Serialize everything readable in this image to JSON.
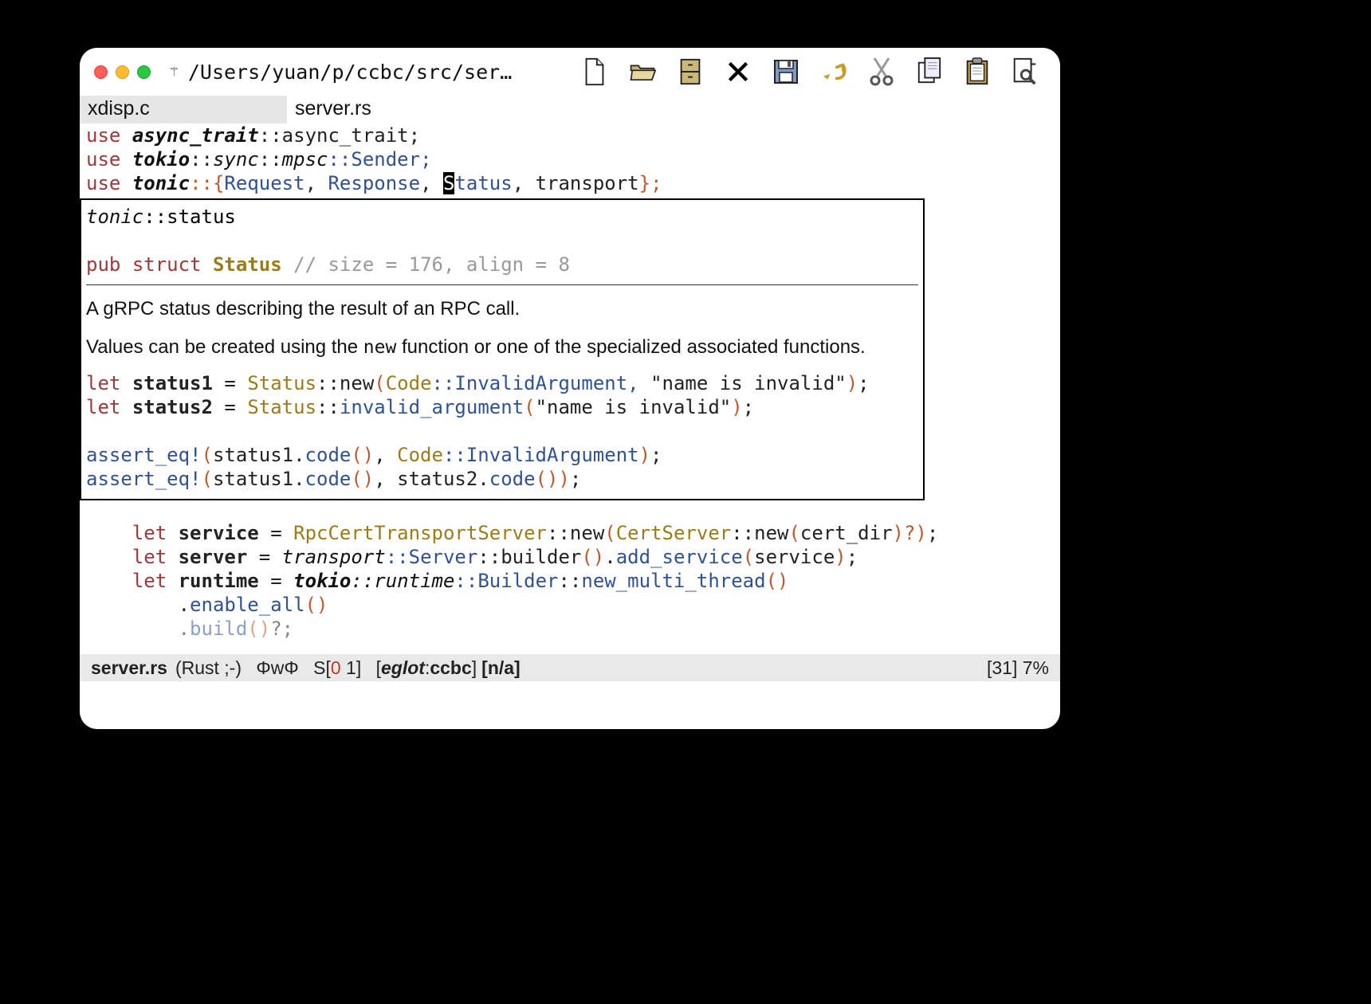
{
  "window": {
    "title_path": "/Users/yuan/p/ccbc/src/server...",
    "vc_glyph": "⚚"
  },
  "toolbar": {
    "new": "new-file",
    "open": "open-folder",
    "dired": "directory",
    "close": "close",
    "save": "save",
    "undo": "undo",
    "cut": "cut",
    "copy": "copy",
    "paste": "paste",
    "search": "search"
  },
  "tabs": [
    {
      "label": "xdisp.c",
      "active": false
    },
    {
      "label": "server.rs",
      "active": true
    }
  ],
  "code": {
    "l1_use": "use",
    "l1_path": "async_trait",
    "l1_rest": "::async_trait;",
    "l2_use": "use",
    "l2_path": "tokio",
    "l2_a": "::",
    "l2_sync": "sync",
    "l2_b": "::",
    "l2_mpsc": "mpsc",
    "l2_sender": "::Sender;",
    "l3_use": "use",
    "l3_path": "tonic",
    "l3_open": "::{",
    "l3_req": "Request",
    "l3_c1": ", ",
    "l3_resp": "Response",
    "l3_c2": ", ",
    "l3_status_S": "S",
    "l3_status_rest": "tatus",
    "l3_c3": ", transport",
    "l3_close": "};"
  },
  "popup": {
    "crate_path_it": "tonic",
    "crate_path_rest": "::status",
    "decl_pub": "pub",
    "decl_struct": "struct",
    "decl_name": "Status",
    "decl_comment": "// size = 176, align = 8",
    "desc1": "A gRPC status describing the result of an RPC call.",
    "desc2a": "Values can be created using the ",
    "desc2b_mono": "new",
    "desc2c": " function or one of the specialized associated functions.",
    "ex_let": "let",
    "ex_s1": "status1",
    "ex_eq": " = ",
    "ex_Status": "Status",
    "ex_new": "::new",
    "ex_po": "(",
    "ex_Code": "Code",
    "ex_inv": "::InvalidArgument, ",
    "ex_str": "\"name is invalid\"",
    "ex_pc": ")",
    "ex_sc": ";",
    "ex_s2": "status2",
    "ex_invarg": "invalid_argument",
    "ex_assert": "assert_eq!",
    "ex_code": "code",
    "ex_status2": "status2"
  },
  "below": {
    "let": "let",
    "service": "service",
    "eq": " = ",
    "rpc": "RpcCertTransportServer",
    "new1": "::new",
    "cs": "CertServer",
    "new2": "::new",
    "cd": "cert_dir",
    "q": ")?)",
    "sc": ";",
    "server": "server",
    "transport": "transport",
    "Server": "::Server",
    "builder": "::builder",
    "add_service": "add_service",
    "svc": "service",
    "runtime": "runtime",
    "tokio": "tokio",
    "rt": "::runtime",
    "Builder": "::Builder",
    "nmt": "new_multi_thread",
    "ena": "enable_all",
    "build": "build"
  },
  "status": {
    "file": "server.rs",
    "mode": "(Rust ;-)",
    "dwd": "ΦwΦ",
    "s_label": "S",
    "s_open": "[",
    "s_err": "0",
    "s_warn": " 1",
    "s_close": "]",
    "eglot_open": "[",
    "eglot_it": "eglot",
    "eglot_colon": ":",
    "eglot_proj": "ccbc",
    "eglot_close": "]",
    "na": "[n/a]",
    "pos": "[31] 7%"
  }
}
